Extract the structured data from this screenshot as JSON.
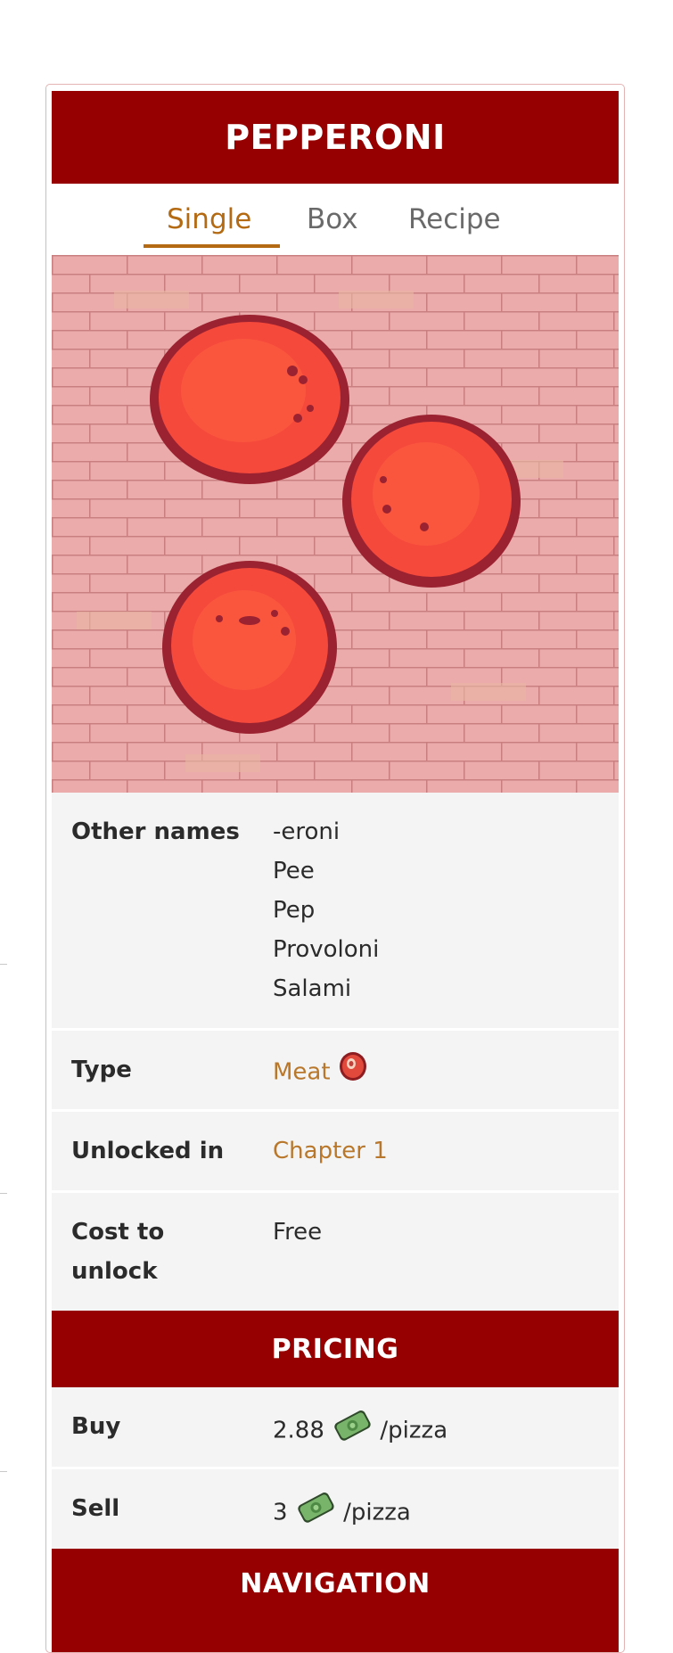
{
  "infobox": {
    "title": "PEPPERONI",
    "tabs": [
      {
        "label": "Single",
        "active": true
      },
      {
        "label": "Box",
        "active": false
      },
      {
        "label": "Recipe",
        "active": false
      }
    ],
    "image_icon": "pepperoni-slices-on-brick-wall",
    "rows": {
      "other_names": {
        "label": "Other names",
        "values": [
          "-eroni",
          "Pee",
          "Pep",
          "Provoloni",
          "Salami"
        ]
      },
      "type": {
        "label": "Type",
        "value": "Meat",
        "icon": "meat-icon"
      },
      "unlocked_in": {
        "label": "Unlocked in",
        "value": "Chapter 1"
      },
      "cost_to_unlock": {
        "label_line1": "Cost to",
        "label_line2": "unlock",
        "value": "Free"
      }
    },
    "pricing": {
      "header": "PRICING",
      "buy": {
        "label": "Buy",
        "value": "2.88",
        "suffix": "/pizza",
        "icon": "money-icon"
      },
      "sell": {
        "label": "Sell",
        "value": "3",
        "suffix": "/pizza",
        "icon": "money-icon"
      }
    },
    "navigation": {
      "header": "NAVIGATION"
    }
  },
  "colors": {
    "header_bg": "#960000",
    "tab_active": "#b46a12",
    "link": "#b8772a",
    "row_bg": "#f4f4f4",
    "wall": "#ecabab"
  }
}
